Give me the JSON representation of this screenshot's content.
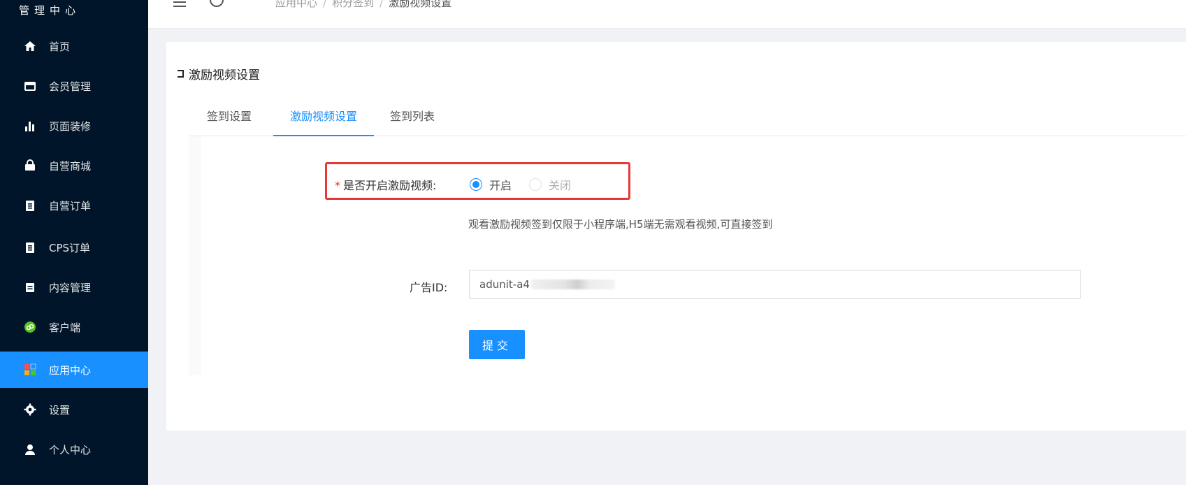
{
  "sidebar": {
    "brand": "管理中心",
    "items": [
      {
        "label": "首页",
        "icon": "home-icon"
      },
      {
        "label": "会员管理",
        "icon": "member-icon"
      },
      {
        "label": "页面装修",
        "icon": "bar-chart-icon"
      },
      {
        "label": "自营商城",
        "icon": "shop-bag-icon"
      },
      {
        "label": "自营订单",
        "icon": "order-icon"
      },
      {
        "label": "CPS订单",
        "icon": "cps-order-icon"
      },
      {
        "label": "内容管理",
        "icon": "content-icon"
      },
      {
        "label": "客户端",
        "icon": "client-icon"
      },
      {
        "label": "应用中心",
        "icon": "app-center-icon",
        "active": true
      },
      {
        "label": "设置",
        "icon": "gear-icon"
      },
      {
        "label": "个人中心",
        "icon": "user-icon"
      }
    ]
  },
  "header": {
    "breadcrumb": [
      "应用中心",
      "积分签到",
      "激励视频设置"
    ]
  },
  "card": {
    "title": "激励视频设置",
    "tabs": [
      {
        "label": "签到设置"
      },
      {
        "label": "激励视频设置",
        "active": true
      },
      {
        "label": "签到列表"
      }
    ]
  },
  "form": {
    "enable_label": "是否开启激励视频:",
    "enable_options": [
      {
        "label": "开启",
        "checked": true
      },
      {
        "label": "关闭",
        "checked": false
      }
    ],
    "hint": "观看激励视频签到仅限于小程序端,H5端无需观看视频,可直接签到",
    "ad_id_label": "广告ID:",
    "ad_id_value": "adunit-a4",
    "submit_label": "提交"
  },
  "colors": {
    "sidebar_bg": "#001529",
    "primary": "#1890ff",
    "highlight_border": "#e53935"
  }
}
